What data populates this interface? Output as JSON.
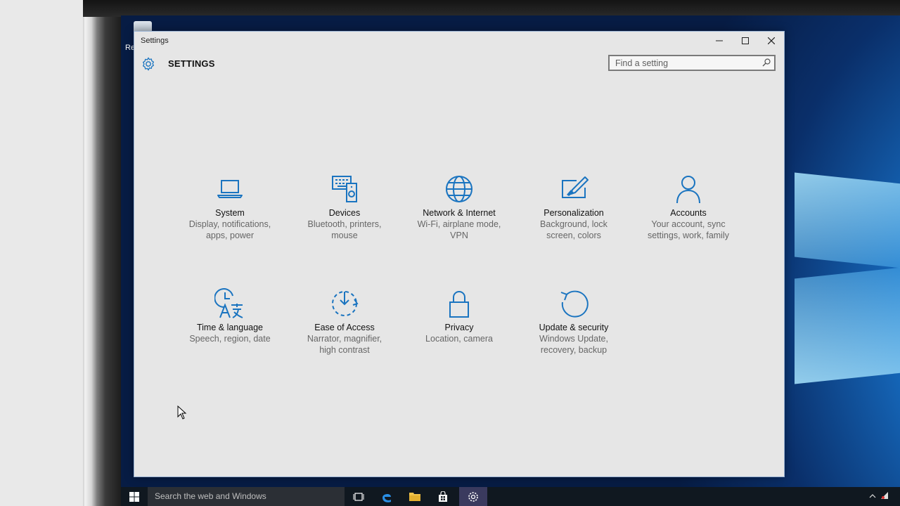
{
  "window": {
    "title": "Settings",
    "minimize_glyph": "—",
    "maximize_glyph": "☐",
    "close_glyph": "✕"
  },
  "header": {
    "icon": "gear-icon",
    "title": "SETTINGS"
  },
  "search": {
    "placeholder": "Find a setting",
    "icon": "search-icon"
  },
  "tiles": [
    {
      "name": "System",
      "desc1": "Display, notifications,",
      "desc2": "apps, power",
      "icon": "laptop-icon"
    },
    {
      "name": "Devices",
      "desc1": "Bluetooth, printers,",
      "desc2": "mouse",
      "icon": "devices-icon"
    },
    {
      "name": "Network & Internet",
      "desc1": "Wi-Fi, airplane mode,",
      "desc2": "VPN",
      "icon": "globe-icon"
    },
    {
      "name": "Personalization",
      "desc1": "Background, lock",
      "desc2": "screen, colors",
      "icon": "personalization-icon"
    },
    {
      "name": "Accounts",
      "desc1": "Your account, sync",
      "desc2": "settings, work, family",
      "icon": "person-icon"
    },
    {
      "name": "Time & language",
      "desc1": "Speech, region, date",
      "desc2": "",
      "icon": "time-language-icon"
    },
    {
      "name": "Ease of Access",
      "desc1": "Narrator, magnifier,",
      "desc2": "high contrast",
      "icon": "ease-of-access-icon"
    },
    {
      "name": "Privacy",
      "desc1": "Location, camera",
      "desc2": "",
      "icon": "lock-icon"
    },
    {
      "name": "Update & security",
      "desc1": "Windows Update,",
      "desc2": "recovery, backup",
      "icon": "refresh-icon"
    }
  ],
  "taskbar": {
    "search_text": "Search the web and Windows",
    "icons": [
      "windows-start-icon",
      "task-view-icon",
      "edge-icon",
      "file-explorer-icon",
      "store-icon",
      "settings-icon"
    ]
  },
  "desktop": {
    "icon_label": "Re"
  },
  "colors": {
    "accent": "#1a74c0",
    "window_bg": "#e6e6e6",
    "taskbar": "#101820"
  }
}
